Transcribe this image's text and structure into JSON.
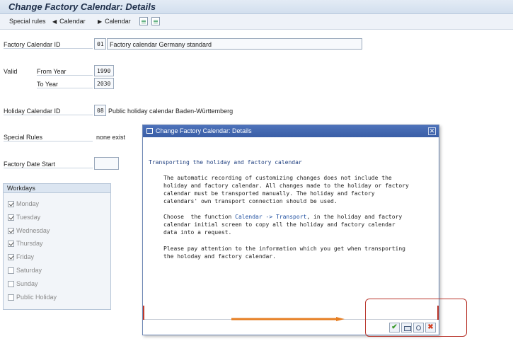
{
  "window": {
    "title": "Change Factory Calendar: Details"
  },
  "toolbar": {
    "special_rules": "Special rules",
    "calendar_prev": "Calendar",
    "calendar_next": "Calendar",
    "prev_icon": "triangle-left",
    "next_icon": "triangle-right"
  },
  "form": {
    "factory_calendar_id_label": "Factory Calendar ID",
    "factory_calendar_id_value": "01",
    "factory_calendar_desc": "Factory calendar Germany standard",
    "valid_label": "Valid",
    "from_year_label": "From Year",
    "from_year_value": "1990",
    "to_year_label": "To Year",
    "to_year_value": "2030",
    "holiday_calendar_id_label": "Holiday Calendar ID",
    "holiday_calendar_id_value": "08",
    "holiday_calendar_desc": "Public holiday calendar Baden-Württemberg",
    "special_rules_label": "Special Rules",
    "special_rules_value": "none exist",
    "factory_date_start_label": "Factory Date Start",
    "factory_date_start_value": ""
  },
  "workdays": {
    "title": "Workdays",
    "days": [
      {
        "label": "Monday",
        "checked": true
      },
      {
        "label": "Tuesday",
        "checked": true
      },
      {
        "label": "Wednesday",
        "checked": true
      },
      {
        "label": "Thursday",
        "checked": true
      },
      {
        "label": "Friday",
        "checked": true
      },
      {
        "label": "Saturday",
        "checked": false
      },
      {
        "label": "Sunday",
        "checked": false
      },
      {
        "label": "Public Holiday",
        "checked": false
      }
    ]
  },
  "dialog": {
    "title": "Change Factory Calendar: Details",
    "heading": "Transporting the holiday and factory calendar",
    "para1_l1": "The automatic recording of customizing changes does not include the",
    "para1_l2": "holiday and factory calendar. All changes made to the holiday or factory",
    "para1_l3": "calendar must be transported manually. The holiday and factory",
    "para1_l4": "calendars' own transport connection should be used.",
    "para2_l1_pre": "Choose  the function ",
    "para2_l1_link": "Calendar -> Transport",
    "para2_l1_post": ", in the holiday and factory",
    "para2_l2": "calendar initial screen to copy all the holiday and factory calendar",
    "para2_l3": "data into a request.",
    "para3_l1": "Please pay attention to the information which you get when transporting",
    "para3_l2": "the holoday and factory calendar.",
    "close_glyph": "✕",
    "ok_glyph": "✔",
    "cancel_glyph": "✖"
  },
  "colors": {
    "annotation": "#b8342a",
    "arrow": "#e67e22",
    "dialog_title_bg": "#3a5ea6"
  }
}
